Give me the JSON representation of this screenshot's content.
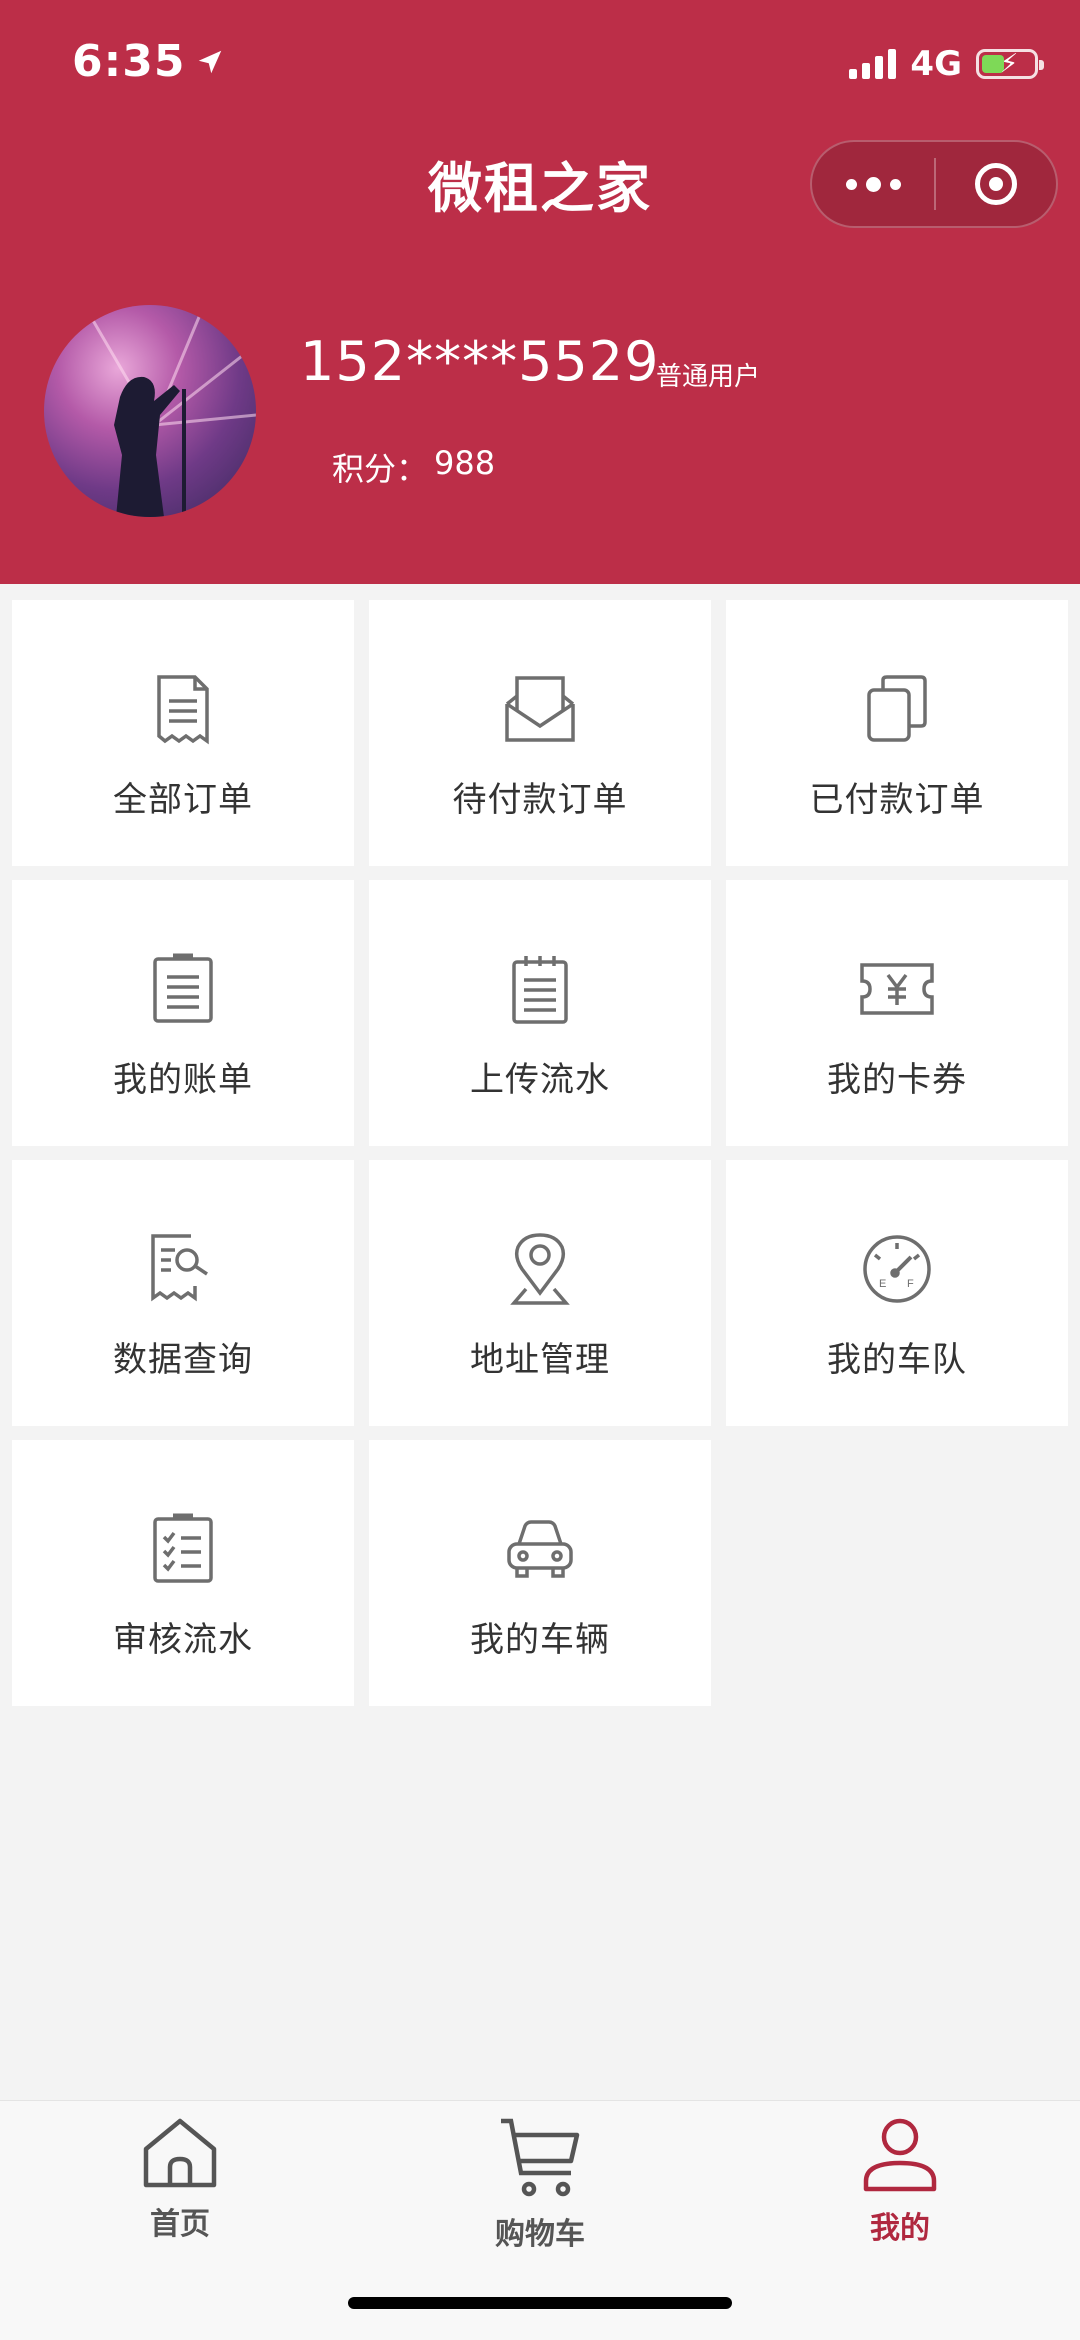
{
  "status_bar": {
    "time": "6:35",
    "network": "4G"
  },
  "header": {
    "title": "微租之家"
  },
  "profile": {
    "phone": "152****5529",
    "role": "普通用户",
    "points_label": "积分：",
    "points_value": "988"
  },
  "menu": [
    {
      "label": "全部订单",
      "icon": "receipt-icon"
    },
    {
      "label": "待付款订单",
      "icon": "envelope-icon"
    },
    {
      "label": "已付款订单",
      "icon": "copy-icon"
    },
    {
      "label": "我的账单",
      "icon": "bill-icon"
    },
    {
      "label": "上传流水",
      "icon": "notepad-icon"
    },
    {
      "label": "我的卡券",
      "icon": "coupon-icon"
    },
    {
      "label": "数据查询",
      "icon": "data-search-icon"
    },
    {
      "label": "地址管理",
      "icon": "location-pin-icon"
    },
    {
      "label": "我的车队",
      "icon": "fuel-gauge-icon"
    },
    {
      "label": "审核流水",
      "icon": "checklist-icon"
    },
    {
      "label": "我的车辆",
      "icon": "car-icon"
    }
  ],
  "tabbar": {
    "items": [
      {
        "label": "首页",
        "icon": "home-icon"
      },
      {
        "label": "购物车",
        "icon": "cart-icon"
      },
      {
        "label": "我的",
        "icon": "user-icon",
        "active": true
      }
    ]
  },
  "colors": {
    "brand": "#bc2e48",
    "active_tab": "#b0283f",
    "icon_gray": "#6e6e6e"
  }
}
